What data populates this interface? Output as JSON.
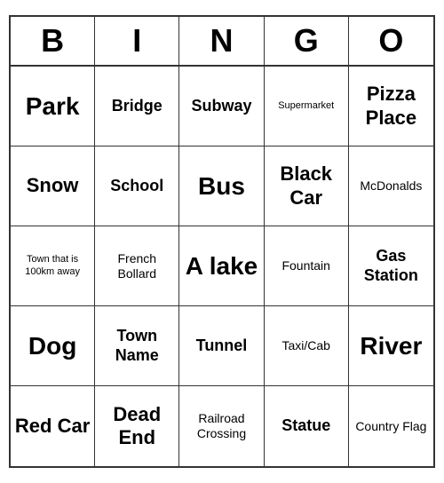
{
  "header": {
    "letters": [
      "B",
      "I",
      "N",
      "G",
      "O"
    ]
  },
  "cells": [
    {
      "text": "Park",
      "size": "xl"
    },
    {
      "text": "Bridge",
      "size": "md"
    },
    {
      "text": "Subway",
      "size": "md"
    },
    {
      "text": "Supermarket",
      "size": "xs"
    },
    {
      "text": "Pizza Place",
      "size": "lg"
    },
    {
      "text": "Snow",
      "size": "lg"
    },
    {
      "text": "School",
      "size": "md"
    },
    {
      "text": "Bus",
      "size": "xl"
    },
    {
      "text": "Black Car",
      "size": "lg"
    },
    {
      "text": "McDonalds",
      "size": "sm"
    },
    {
      "text": "Town that is 100km away",
      "size": "xs"
    },
    {
      "text": "French Bollard",
      "size": "sm"
    },
    {
      "text": "A lake",
      "size": "xl"
    },
    {
      "text": "Fountain",
      "size": "sm"
    },
    {
      "text": "Gas Station",
      "size": "md"
    },
    {
      "text": "Dog",
      "size": "xl"
    },
    {
      "text": "Town Name",
      "size": "md"
    },
    {
      "text": "Tunnel",
      "size": "md"
    },
    {
      "text": "Taxi/Cab",
      "size": "sm"
    },
    {
      "text": "River",
      "size": "xl"
    },
    {
      "text": "Red Car",
      "size": "lg"
    },
    {
      "text": "Dead End",
      "size": "lg"
    },
    {
      "text": "Railroad Crossing",
      "size": "sm"
    },
    {
      "text": "Statue",
      "size": "md"
    },
    {
      "text": "Country Flag",
      "size": "sm"
    }
  ]
}
